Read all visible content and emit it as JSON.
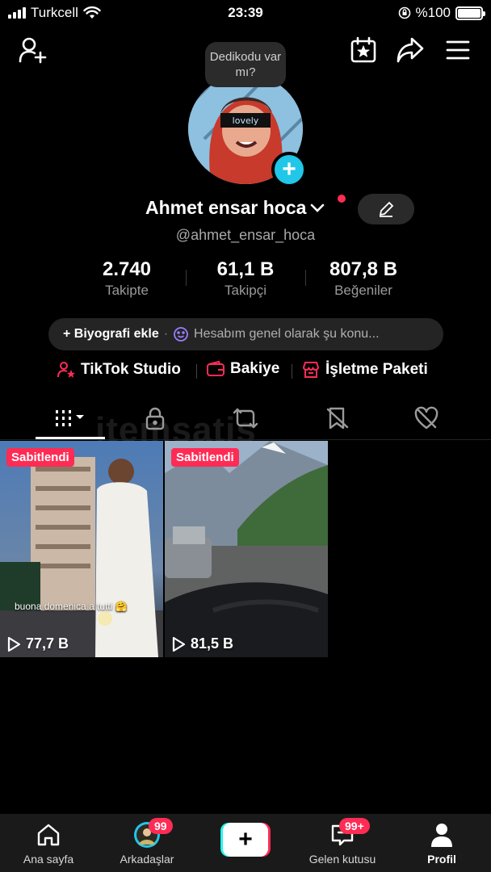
{
  "status_bar": {
    "carrier": "Turkcell",
    "time": "23:39",
    "battery": "%100"
  },
  "bubble": {
    "text": "Dedikodu var mı?"
  },
  "profile": {
    "name": "Ahmet ensar hoca",
    "handle": "@ahmet_ensar_hoca",
    "avatar_text": "lovely"
  },
  "stats": [
    {
      "value": "2.740",
      "label": "Takipte"
    },
    {
      "value": "61,1 B",
      "label": "Takipçi"
    },
    {
      "value": "807,8 B",
      "label": "Beğeniler"
    }
  ],
  "bio": {
    "add_label": "+ Biyografi ekle",
    "separator": "·",
    "prompt": "Hesabım genel olarak şu konu..."
  },
  "links": [
    {
      "label": "TikTok Studio",
      "icon": "user-star-icon"
    },
    {
      "label": "Bakiye",
      "icon": "wallet-icon"
    },
    {
      "label": "İşletme Paketi",
      "icon": "store-icon"
    }
  ],
  "tabs": [
    "videos-grid-icon",
    "lock-icon",
    "repost-icon",
    "bookmark-icon",
    "liked-icon"
  ],
  "watermark": "itemsatis",
  "videos": [
    {
      "badge": "Sabitlendi",
      "views": "77,7 B",
      "caption": "buona domenica a tutti 🤗"
    },
    {
      "badge": "Sabitlendi",
      "views": "81,5 B"
    }
  ],
  "nav": {
    "home": "Ana sayfa",
    "friends": "Arkadaşlar",
    "friends_badge": "99",
    "inbox": "Gelen kutusu",
    "inbox_badge": "99+",
    "profile": "Profil",
    "create": "+"
  },
  "colors": {
    "accent": "#fe2c55",
    "cyan": "#20c7e8",
    "background": "#000000"
  }
}
